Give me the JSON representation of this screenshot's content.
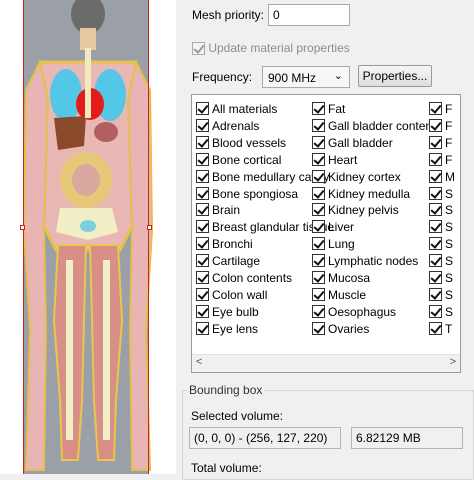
{
  "mesh_priority": {
    "label": "Mesh priority:",
    "value": "0"
  },
  "update_material": {
    "label": "Update material properties",
    "checked": true,
    "enabled": false
  },
  "frequency": {
    "label": "Frequency:",
    "value": "900 MHz"
  },
  "properties_button": "Properties...",
  "materials": {
    "col1": [
      "All materials",
      "Adrenals",
      "Blood vessels",
      "Bone cortical",
      "Bone medullary cavity",
      "Bone spongiosa",
      "Brain",
      "Breast glandular tissue",
      "Bronchi",
      "Cartilage",
      "Colon contents",
      "Colon wall",
      "Eye bulb",
      "Eye lens"
    ],
    "col2": [
      "Fat",
      "Gall bladder contents",
      "Gall bladder",
      "Heart",
      "Kidney cortex",
      "Kidney medulla",
      "Kidney pelvis",
      "Liver",
      "Lung",
      "Lymphatic nodes",
      "Mucosa",
      "Muscle",
      "Oesophagus",
      "Ovaries"
    ],
    "col3": [
      "F",
      "F",
      "F",
      "F",
      "M",
      "S",
      "S",
      "S",
      "S",
      "S",
      "S",
      "S",
      "S",
      "T"
    ]
  },
  "bounding_box": {
    "label": "Bounding box",
    "selected_label": "Selected volume:",
    "selected_range": "(0, 0, 0) - (256, 127, 220)",
    "selected_size": "6.82129 MB",
    "total_label": "Total volume:"
  },
  "colors": {
    "background": "#9b9fa8",
    "selection": "#cc2222"
  },
  "icons": {
    "dropdown": "chevron-down-icon",
    "scroll_left": "arrow-left-icon",
    "scroll_right": "arrow-right-icon"
  }
}
